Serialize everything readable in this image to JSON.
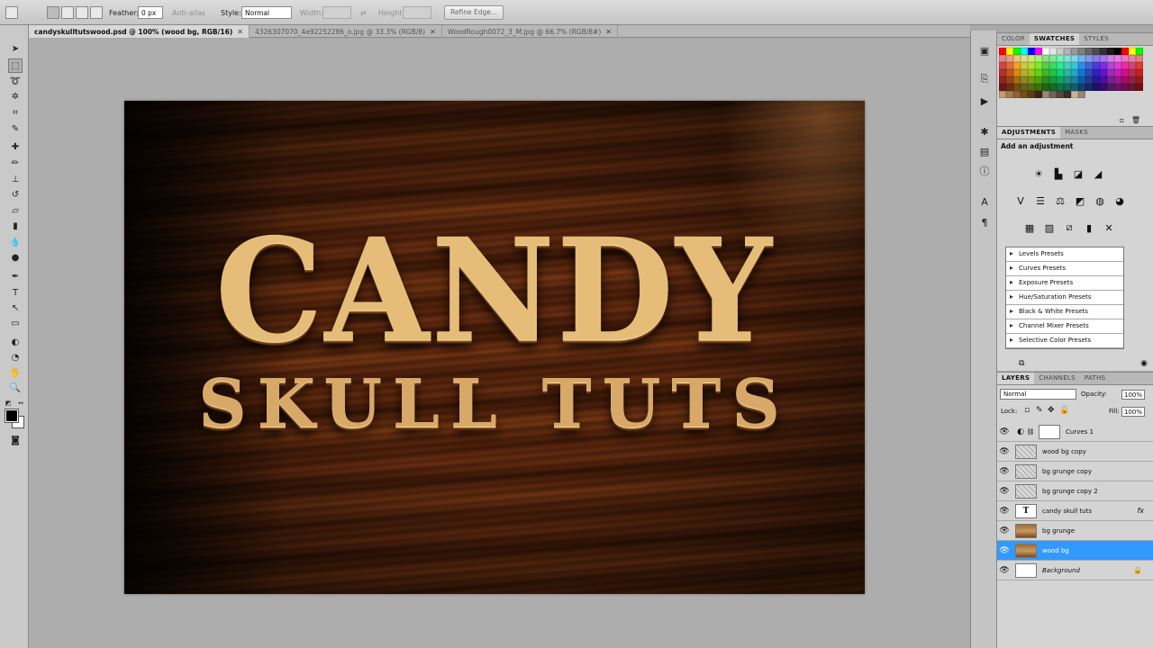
{
  "options_bar": {
    "feather_label": "Feather:",
    "feather_value": "0 px",
    "antialias_label": "Anti-alias",
    "style_label": "Style:",
    "style_value": "Normal",
    "width_label": "Width:",
    "height_label": "Height:",
    "refine_edge_label": "Refine Edge..."
  },
  "tabs": [
    {
      "label": "candyskulltutswood.psd @ 100% (wood bg, RGB/16)",
      "active": true
    },
    {
      "label": "4326307070_4e92252286_o.jpg @ 33.3% (RGB/8)",
      "active": false
    },
    {
      "label": "WoodRough0072_3_M.jpg @ 66.7% (RGB/8#)",
      "active": false
    }
  ],
  "artwork": {
    "title": "CANDY",
    "subtitle": "SKULL TUTS"
  },
  "color_panel": {
    "tabs": [
      "COLOR",
      "SWATCHES",
      "STYLES"
    ],
    "active_tab": "SWATCHES"
  },
  "adjustments_panel": {
    "tabs": [
      "ADJUSTMENTS",
      "MASKS"
    ],
    "heading": "Add an adjustment",
    "presets": [
      "Levels Presets",
      "Curves Presets",
      "Exposure Presets",
      "Hue/Saturation Presets",
      "Black & White Presets",
      "Channel Mixer Presets",
      "Selective Color Presets"
    ]
  },
  "layers_panel": {
    "tabs": [
      "LAYERS",
      "CHANNELS",
      "PATHS"
    ],
    "blend_mode": "Normal",
    "opacity_label": "Opacity:",
    "opacity_value": "100%",
    "lock_label": "Lock:",
    "fill_label": "Fill:",
    "fill_value": "100%",
    "layers": [
      {
        "name": "Curves 1",
        "thumb": "adjust",
        "selected": false,
        "italic": false
      },
      {
        "name": "wood bg copy",
        "thumb": "grunge",
        "selected": false,
        "italic": false
      },
      {
        "name": "bg grunge copy",
        "thumb": "grunge",
        "selected": false,
        "italic": false
      },
      {
        "name": "bg grunge copy 2",
        "thumb": "grunge",
        "selected": false,
        "italic": false
      },
      {
        "name": "candy skull tuts",
        "thumb": "text",
        "selected": false,
        "italic": false
      },
      {
        "name": "bg grunge",
        "thumb": "wood",
        "selected": false,
        "italic": false
      },
      {
        "name": "wood bg",
        "thumb": "wood",
        "selected": true,
        "italic": false
      },
      {
        "name": "Background",
        "thumb": "white",
        "selected": false,
        "italic": true
      }
    ]
  },
  "colors": {
    "foreground": "#000000",
    "background": "#ffffff",
    "selection": "#3399ff"
  }
}
